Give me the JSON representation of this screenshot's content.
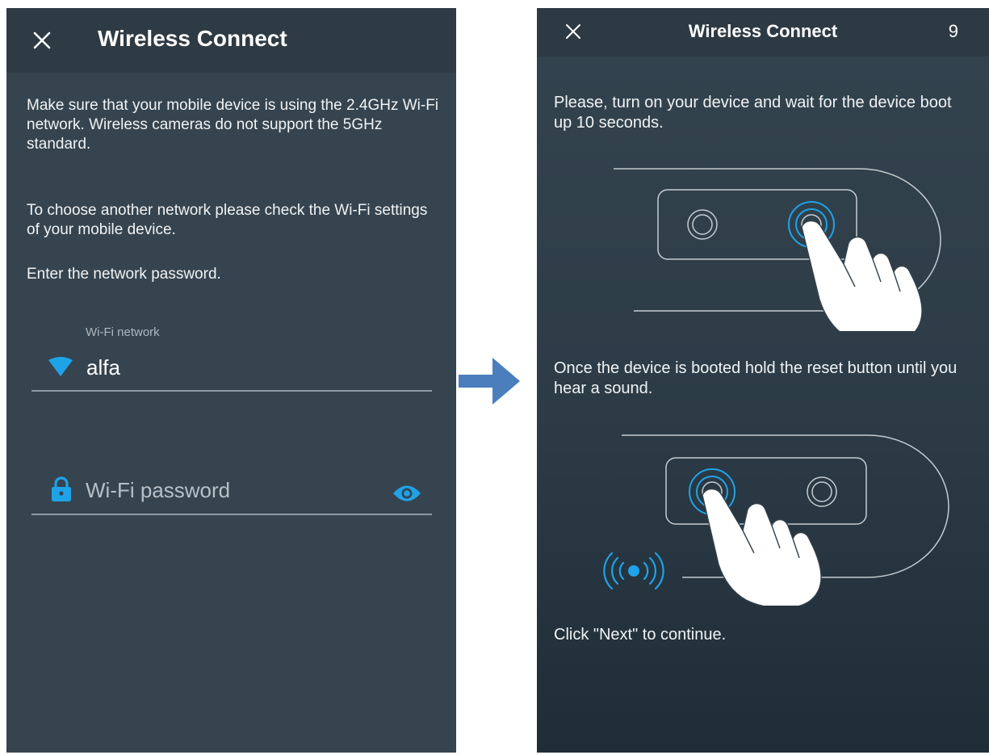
{
  "left_screen": {
    "header": {
      "title": "Wireless Connect"
    },
    "paragraphs": [
      "Make sure that your mobile device is using the 2.4GHz Wi-Fi network. Wireless cameras do not support the 5GHz standard.",
      "To choose another network please check the Wi-Fi settings of your mobile device.",
      "Enter the network password."
    ],
    "wifi_field": {
      "label": "Wi-Fi network",
      "value": "alfa"
    },
    "password_field": {
      "placeholder": "Wi-Fi password"
    }
  },
  "right_screen": {
    "header": {
      "title": "Wireless Connect",
      "counter": "9"
    },
    "step1_text": "Please, turn on your device and wait for the device boot up 10 seconds.",
    "step2_text": "Once the device is booted hold the reset button until you hear a sound.",
    "footer_text": "Click \"Next\" to continue."
  },
  "colors": {
    "accent": "#1fa3e8",
    "left_background": "#36444f",
    "left_header": "#2e3b45",
    "right_header": "#2d3a44",
    "arrow": "#4a7ebd"
  },
  "icons": [
    "close-icon",
    "wifi-icon",
    "lock-icon",
    "eye-icon",
    "arrow-right-icon",
    "hand-pointer-icon",
    "sound-waves-icon"
  ]
}
